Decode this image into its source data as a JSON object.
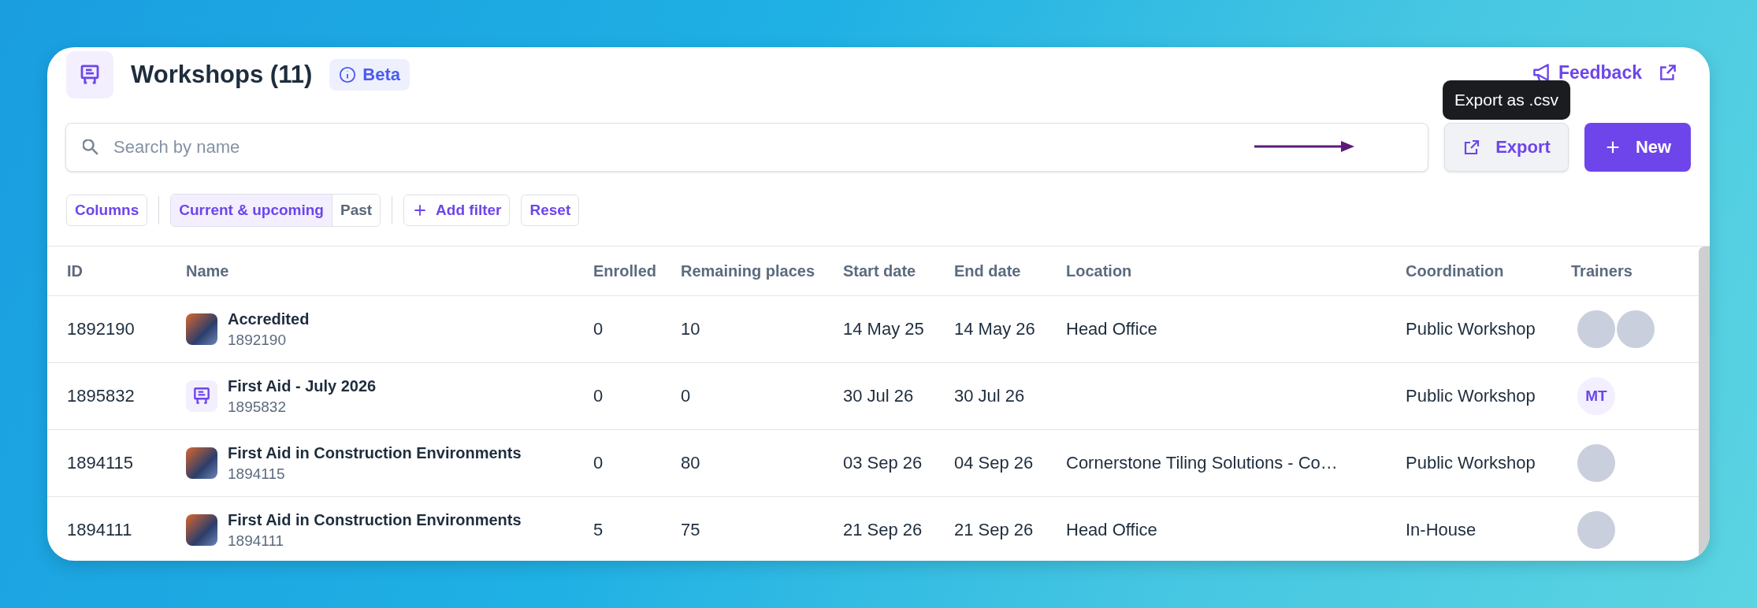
{
  "header": {
    "title": "Workshops (11)",
    "badge": "Beta",
    "feedback": "Feedback"
  },
  "search": {
    "placeholder": "Search by name"
  },
  "tooltip": "Export as .csv",
  "actions": {
    "export": "Export",
    "new": "New"
  },
  "filters": {
    "columns": "Columns",
    "segments": [
      {
        "label": "Current & upcoming",
        "selected": true
      },
      {
        "label": "Past",
        "selected": false
      }
    ],
    "add_filter": "Add filter",
    "reset": "Reset"
  },
  "table": {
    "columns": [
      "ID",
      "Name",
      "Enrolled",
      "Remaining places",
      "Start date",
      "End date",
      "Location",
      "Coordination",
      "Trainers"
    ],
    "rows": [
      {
        "id": "1892190",
        "thumbnail": {
          "kind": "photo"
        },
        "name": "Accredited",
        "sub": "1892190",
        "enrolled": "0",
        "remaining": "10",
        "start": "14 May 25",
        "end": "14 May 26",
        "location": "Head Office",
        "coordination": "Public Workshop",
        "trainers": [
          {
            "kind": "photo"
          },
          {
            "kind": "photo"
          }
        ]
      },
      {
        "id": "1895832",
        "thumbnail": {
          "kind": "icon"
        },
        "name": "First Aid - July 2026",
        "sub": "1895832",
        "enrolled": "0",
        "remaining": "0",
        "start": "30 Jul 26",
        "end": "30 Jul 26",
        "location": "",
        "coordination": "Public Workshop",
        "trainers": [
          {
            "kind": "initials",
            "text": "MT"
          }
        ]
      },
      {
        "id": "1894115",
        "thumbnail": {
          "kind": "photo"
        },
        "name": "First Aid in Construction Environments",
        "sub": "1894115",
        "enrolled": "0",
        "remaining": "80",
        "start": "03 Sep 26",
        "end": "04 Sep 26",
        "location": "Cornerstone Tiling Solutions - Co…",
        "coordination": "Public Workshop",
        "trainers": [
          {
            "kind": "photo"
          }
        ]
      },
      {
        "id": "1894111",
        "thumbnail": {
          "kind": "photo"
        },
        "name": "First Aid in Construction Environments",
        "sub": "1894111",
        "enrolled": "5",
        "remaining": "75",
        "start": "21 Sep 26",
        "end": "21 Sep 26",
        "location": "Head Office",
        "coordination": "In-House",
        "trainers": [
          {
            "kind": "photo"
          }
        ]
      }
    ]
  }
}
